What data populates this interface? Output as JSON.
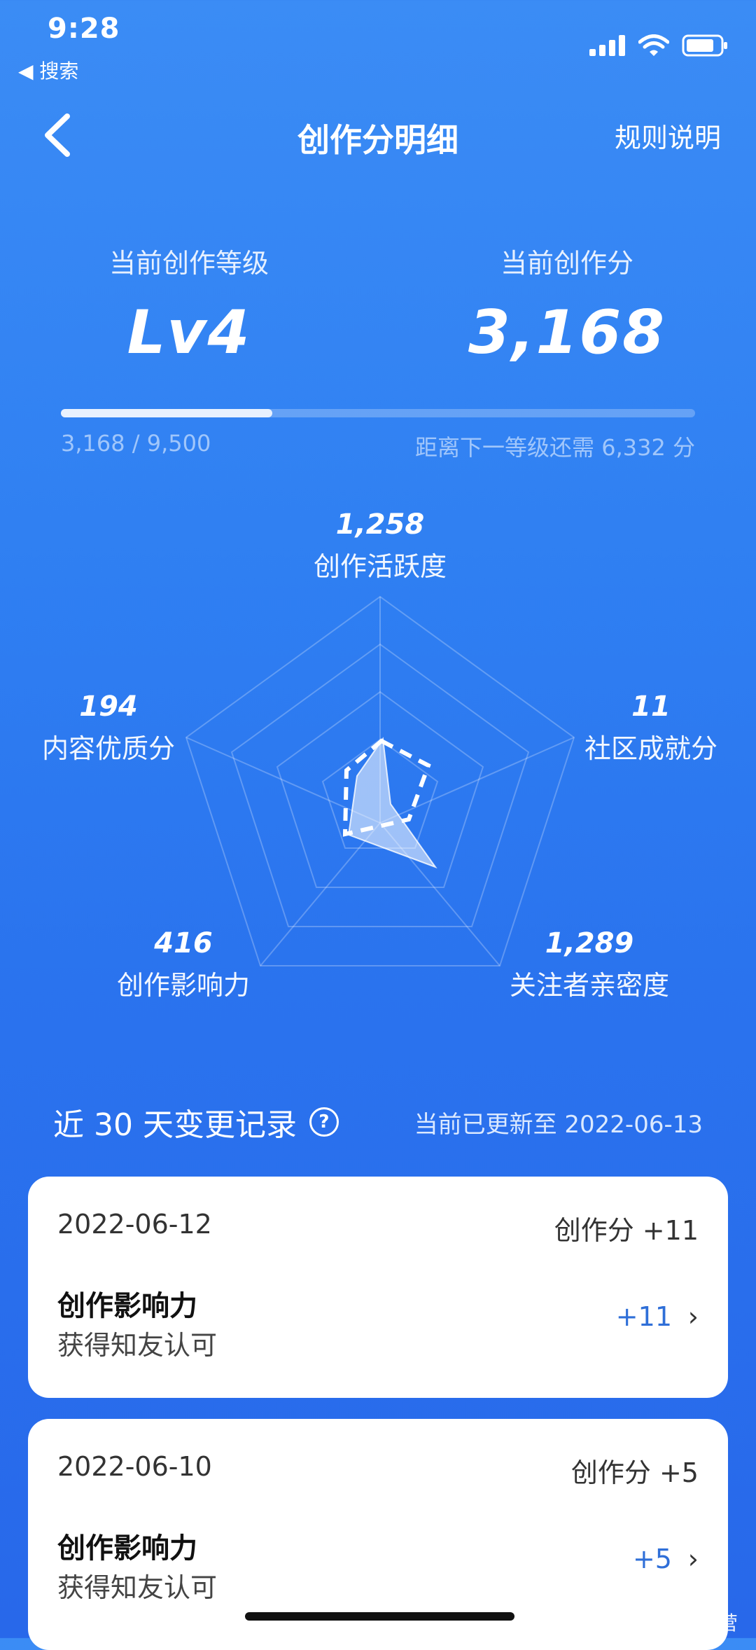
{
  "status_bar": {
    "time": "9:28",
    "back_app": "◀ 搜索"
  },
  "nav": {
    "title": "创作分明细",
    "rules": "规则说明"
  },
  "stats": {
    "level_label": "当前创作等级",
    "level_value": "Lv4",
    "score_label": "当前创作分",
    "score_value": "3,168",
    "progress_fraction": 0.333,
    "progress_text": "3,168 / 9,500",
    "remaining_text": "距离下一等级还需 6,332 分"
  },
  "radar": {
    "dimensions": [
      {
        "value": "1,258",
        "label": "创作活跃度"
      },
      {
        "value": "11",
        "label": "社区成就分"
      },
      {
        "value": "1,289",
        "label": "关注者亲密度"
      },
      {
        "value": "416",
        "label": "创作影响力"
      },
      {
        "value": "194",
        "label": "内容优质分"
      }
    ]
  },
  "records": {
    "title": "近 30 天变更记录",
    "help_icon": "question-circle-icon",
    "updated": "当前已更新至 2022-06-13",
    "items": [
      {
        "date": "2022-06-12",
        "total": "创作分 +11",
        "category": "创作影响力",
        "reason": "获得知友认可",
        "delta": "+11"
      },
      {
        "date": "2022-06-10",
        "total": "创作分 +5",
        "category": "创作影响力",
        "reason": "获得知友认可",
        "delta": "+5"
      }
    ]
  },
  "watermark": "杨学姐聊运营",
  "colors": {
    "bg_top": "#3b8cf5",
    "bg_bottom": "#2868ea",
    "accent": "#2f6fd8"
  }
}
